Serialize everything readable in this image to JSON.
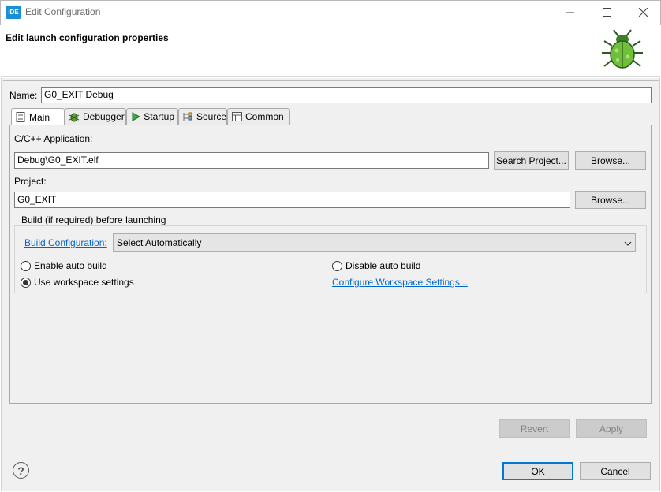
{
  "window": {
    "app_icon_text": "IDE",
    "title": "Edit Configuration",
    "minimize_icon": "minimize-icon",
    "maximize_icon": "maximize-icon",
    "close_icon": "close-icon"
  },
  "header": {
    "title": "Edit launch configuration properties",
    "banner_icon": "debug-bug-icon"
  },
  "name_field": {
    "label": "Name:",
    "value": "G0_EXIT Debug"
  },
  "tabs": [
    {
      "label": "Main",
      "icon": "document-icon",
      "active": true
    },
    {
      "label": "Debugger",
      "icon": "bug-icon",
      "active": false
    },
    {
      "label": "Startup",
      "icon": "play-icon",
      "active": false
    },
    {
      "label": "Source",
      "icon": "source-icon",
      "active": false
    },
    {
      "label": "Common",
      "icon": "table-icon",
      "active": false
    }
  ],
  "main": {
    "application_label": "C/C++ Application:",
    "application_value": "Debug\\G0_EXIT.elf",
    "search_project_label": "Search Project...",
    "browse_label": "Browse...",
    "project_label": "Project:",
    "project_value": "G0_EXIT",
    "project_browse_label": "Browse...",
    "build_group": {
      "title": "Build (if required) before launching",
      "build_config_link": "Build Configuration:",
      "build_config_value": "Select Automatically",
      "enable_auto_build": "Enable auto build",
      "disable_auto_build": "Disable auto build",
      "use_workspace_settings": "Use workspace settings",
      "configure_workspace_link": "Configure Workspace Settings...",
      "selected": "use_workspace_settings"
    }
  },
  "buttons": {
    "revert": "Revert",
    "apply": "Apply",
    "ok": "OK",
    "cancel": "Cancel",
    "help_glyph": "?"
  },
  "colors": {
    "accent": "#0078d7",
    "link": "#0066cc",
    "dialog_bg": "#f0f0f0"
  }
}
